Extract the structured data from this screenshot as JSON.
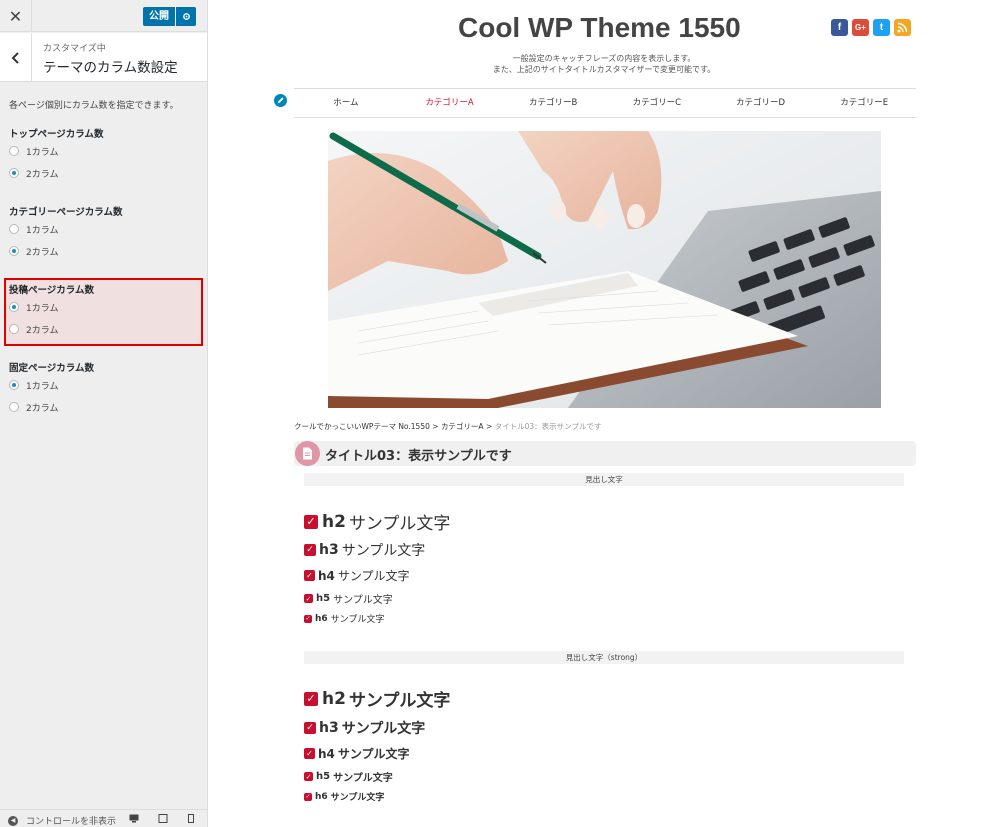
{
  "sidebar": {
    "close_icon": "close-icon",
    "publish_label": "公開",
    "customizing_label": "カスタマイズ中",
    "section_title": "テーマのカラム数設定",
    "description": "各ページ個別にカラム数を指定できます。",
    "groups": [
      {
        "title": "トップページカラム数",
        "options": [
          "1カラム",
          "2カラム"
        ],
        "selected": "2カラム"
      },
      {
        "title": "カテゴリーページカラム数",
        "options": [
          "1カラム",
          "2カラム"
        ],
        "selected": "2カラム"
      },
      {
        "title": "投稿ページカラム数",
        "options": [
          "1カラム",
          "2カラム"
        ],
        "selected": "1カラム",
        "highlighted": true
      },
      {
        "title": "固定ページカラム数",
        "options": [
          "1カラム",
          "2カラム"
        ],
        "selected": "1カラム"
      }
    ],
    "footer": {
      "hide_controls_label": "コントロールを非表示"
    },
    "accent_color": "#0073aa",
    "highlight_border_color": "#e00000"
  },
  "preview": {
    "site_title": "Cool WP Theme 1550",
    "tagline_line1": "一般設定のキャッチフレーズの内容を表示します。",
    "tagline_line2": "また、上記のサイトタイトルカスタマイザーで変更可能です。",
    "social": [
      {
        "name": "facebook",
        "glyph": "f",
        "color": "#3b5998"
      },
      {
        "name": "google-plus",
        "glyph": "G+",
        "color": "#dd4b39"
      },
      {
        "name": "twitter",
        "glyph": "t",
        "color": "#1da1f2"
      },
      {
        "name": "rss",
        "glyph": "◉",
        "color": "#f5a623"
      }
    ],
    "nav": [
      "ホーム",
      "カテゴリーA",
      "カテゴリーB",
      "カテゴリーC",
      "カテゴリーD",
      "カテゴリーE"
    ],
    "nav_active": "カテゴリーA",
    "breadcrumb": {
      "home": "クールでかっこいいWPテーマ No.1550",
      "sep": " > ",
      "category": "カテゴリーA",
      "current": "タイトル03：表示サンプルです"
    },
    "post_title": "タイトル03：表示サンプルです",
    "section1_label": "見出し文字",
    "section2_label": "見出し文字（strong）",
    "headings_text": "サンプル文字",
    "headings": [
      "h2",
      "h3",
      "h4",
      "h5",
      "h6"
    ],
    "accent_color": "#c8102e"
  }
}
